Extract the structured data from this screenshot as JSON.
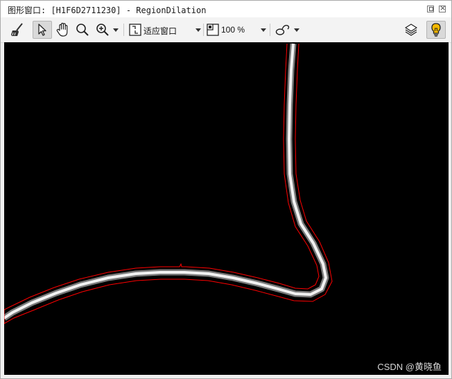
{
  "window": {
    "title": "图形窗口: [H1F6D2711230] - RegionDilation",
    "controls": [
      "restore-icon",
      "close-icon"
    ]
  },
  "toolbar": {
    "tools": [
      "broom-icon",
      "pointer-icon",
      "hand-pan-icon",
      "magnifier-icon",
      "zoom-in-icon",
      "fit-window-icon",
      "zoom-percent-icon",
      "draw-shape-icon",
      "layers-icon",
      "lightbulb-icon"
    ],
    "fit_label": "适应窗口",
    "zoom_label": "100 %"
  },
  "colors": {
    "canvas_background": "#000000",
    "region_outline": "#ff0000",
    "lightbulb": "#f5b800"
  },
  "watermark": "CSDN @黄晓鱼"
}
